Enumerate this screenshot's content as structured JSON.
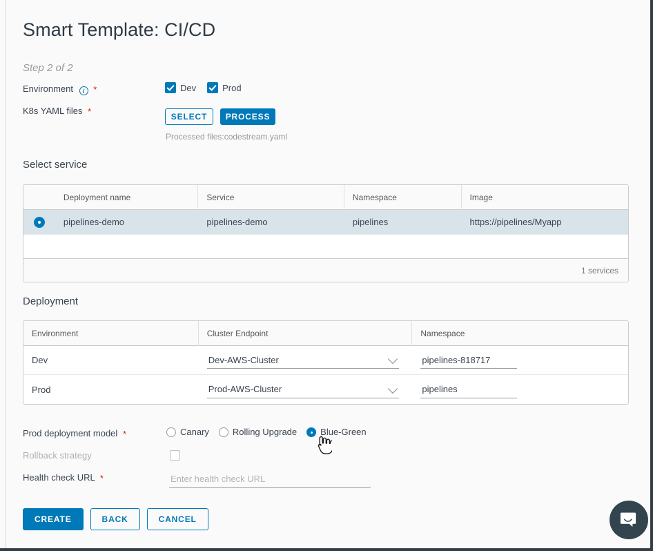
{
  "page": {
    "title": "Smart Template: CI/CD",
    "step_label": "Step 2 of 2"
  },
  "environment_field": {
    "label": "Environment",
    "info_icon": "info-icon",
    "required_mark": "*",
    "options": [
      {
        "label": "Dev",
        "checked": true
      },
      {
        "label": "Prod",
        "checked": true
      }
    ]
  },
  "yaml_field": {
    "label": "K8s YAML files",
    "required_mark": "*",
    "select_button": "SELECT",
    "process_button": "PROCESS",
    "processed_note": "Processed files:codestream.yaml"
  },
  "select_service": {
    "heading": "Select service",
    "columns": [
      "",
      "Deployment name",
      "Service",
      "Namespace",
      "Image"
    ],
    "rows": [
      {
        "selected": true,
        "deployment_name": "pipelines-demo",
        "service": "pipelines-demo",
        "namespace": "pipelines",
        "image": "https://pipelines/Myapp"
      }
    ],
    "footer_count": "1 services"
  },
  "deployment": {
    "heading": "Deployment",
    "columns": [
      "Environment",
      "Cluster Endpoint",
      "Namespace"
    ],
    "rows": [
      {
        "environment": "Dev",
        "cluster_endpoint": "Dev-AWS-Cluster",
        "namespace": "pipelines-818717"
      },
      {
        "environment": "Prod",
        "cluster_endpoint": "Prod-AWS-Cluster",
        "namespace": "pipelines"
      }
    ]
  },
  "prod_deployment_model": {
    "label": "Prod deployment model",
    "required_mark": "*",
    "options": [
      {
        "label": "Canary",
        "selected": false
      },
      {
        "label": "Rolling Upgrade",
        "selected": false
      },
      {
        "label": "Blue-Green",
        "selected": true
      }
    ]
  },
  "rollback_strategy": {
    "label": "Rollback strategy",
    "checked": false,
    "disabled": true
  },
  "health_check": {
    "label": "Health check URL",
    "required_mark": "*",
    "value": "",
    "placeholder": "Enter health check URL"
  },
  "footer": {
    "create_button": "CREATE",
    "back_button": "BACK",
    "cancel_button": "CANCEL"
  },
  "chat": {
    "icon": "chat-bubble-icon"
  },
  "colors": {
    "accent": "#0079b8",
    "required": "#e02200",
    "selected_row": "#d9e4ea",
    "chat_bg": "#32454f",
    "page_bg": "#fafafa"
  }
}
